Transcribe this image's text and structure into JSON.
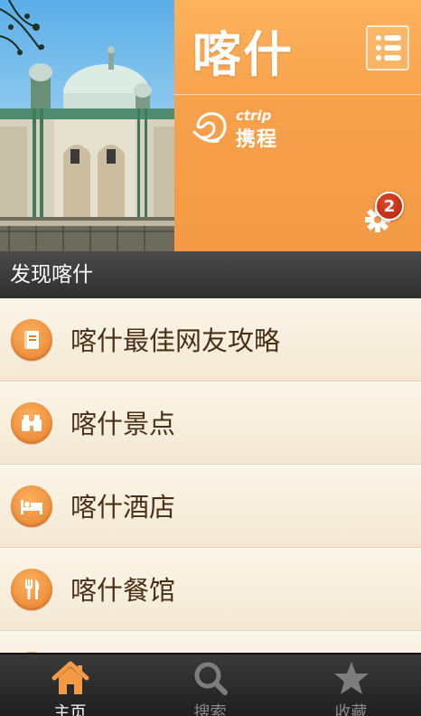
{
  "header": {
    "city": "喀什",
    "logo_en": "ctrip",
    "logo_cn": "携程",
    "notification_count": "2"
  },
  "section": {
    "title": "发现喀什"
  },
  "list": [
    {
      "label": "喀什最佳网友攻略",
      "icon": "book-icon"
    },
    {
      "label": "喀什景点",
      "icon": "binoculars-icon"
    },
    {
      "label": "喀什酒店",
      "icon": "bed-icon"
    },
    {
      "label": "喀什餐馆",
      "icon": "fork-knife-icon"
    }
  ],
  "tabs": [
    {
      "label": "主页",
      "icon": "home-icon",
      "active": true
    },
    {
      "label": "搜索",
      "icon": "search-icon",
      "active": false
    },
    {
      "label": "收藏",
      "icon": "star-icon",
      "active": false
    }
  ],
  "colors": {
    "accent": "#f7a04b",
    "tabbar": "#2a2a2a",
    "section_bar": "#3a3a3a",
    "list_text": "#4a2f16"
  }
}
